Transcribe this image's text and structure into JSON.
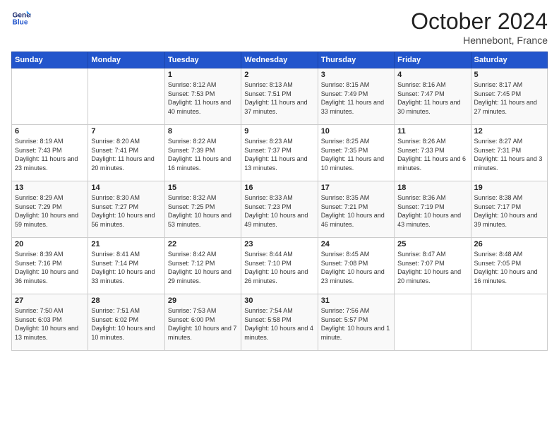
{
  "header": {
    "logo": {
      "line1": "General",
      "line2": "Blue"
    },
    "month_year": "October 2024",
    "location": "Hennebont, France"
  },
  "days_of_week": [
    "Sunday",
    "Monday",
    "Tuesday",
    "Wednesday",
    "Thursday",
    "Friday",
    "Saturday"
  ],
  "weeks": [
    [
      {
        "day": "",
        "sunrise": "",
        "sunset": "",
        "daylight": ""
      },
      {
        "day": "",
        "sunrise": "",
        "sunset": "",
        "daylight": ""
      },
      {
        "day": "1",
        "sunrise": "Sunrise: 8:12 AM",
        "sunset": "Sunset: 7:53 PM",
        "daylight": "Daylight: 11 hours and 40 minutes."
      },
      {
        "day": "2",
        "sunrise": "Sunrise: 8:13 AM",
        "sunset": "Sunset: 7:51 PM",
        "daylight": "Daylight: 11 hours and 37 minutes."
      },
      {
        "day": "3",
        "sunrise": "Sunrise: 8:15 AM",
        "sunset": "Sunset: 7:49 PM",
        "daylight": "Daylight: 11 hours and 33 minutes."
      },
      {
        "day": "4",
        "sunrise": "Sunrise: 8:16 AM",
        "sunset": "Sunset: 7:47 PM",
        "daylight": "Daylight: 11 hours and 30 minutes."
      },
      {
        "day": "5",
        "sunrise": "Sunrise: 8:17 AM",
        "sunset": "Sunset: 7:45 PM",
        "daylight": "Daylight: 11 hours and 27 minutes."
      }
    ],
    [
      {
        "day": "6",
        "sunrise": "Sunrise: 8:19 AM",
        "sunset": "Sunset: 7:43 PM",
        "daylight": "Daylight: 11 hours and 23 minutes."
      },
      {
        "day": "7",
        "sunrise": "Sunrise: 8:20 AM",
        "sunset": "Sunset: 7:41 PM",
        "daylight": "Daylight: 11 hours and 20 minutes."
      },
      {
        "day": "8",
        "sunrise": "Sunrise: 8:22 AM",
        "sunset": "Sunset: 7:39 PM",
        "daylight": "Daylight: 11 hours and 16 minutes."
      },
      {
        "day": "9",
        "sunrise": "Sunrise: 8:23 AM",
        "sunset": "Sunset: 7:37 PM",
        "daylight": "Daylight: 11 hours and 13 minutes."
      },
      {
        "day": "10",
        "sunrise": "Sunrise: 8:25 AM",
        "sunset": "Sunset: 7:35 PM",
        "daylight": "Daylight: 11 hours and 10 minutes."
      },
      {
        "day": "11",
        "sunrise": "Sunrise: 8:26 AM",
        "sunset": "Sunset: 7:33 PM",
        "daylight": "Daylight: 11 hours and 6 minutes."
      },
      {
        "day": "12",
        "sunrise": "Sunrise: 8:27 AM",
        "sunset": "Sunset: 7:31 PM",
        "daylight": "Daylight: 11 hours and 3 minutes."
      }
    ],
    [
      {
        "day": "13",
        "sunrise": "Sunrise: 8:29 AM",
        "sunset": "Sunset: 7:29 PM",
        "daylight": "Daylight: 10 hours and 59 minutes."
      },
      {
        "day": "14",
        "sunrise": "Sunrise: 8:30 AM",
        "sunset": "Sunset: 7:27 PM",
        "daylight": "Daylight: 10 hours and 56 minutes."
      },
      {
        "day": "15",
        "sunrise": "Sunrise: 8:32 AM",
        "sunset": "Sunset: 7:25 PM",
        "daylight": "Daylight: 10 hours and 53 minutes."
      },
      {
        "day": "16",
        "sunrise": "Sunrise: 8:33 AM",
        "sunset": "Sunset: 7:23 PM",
        "daylight": "Daylight: 10 hours and 49 minutes."
      },
      {
        "day": "17",
        "sunrise": "Sunrise: 8:35 AM",
        "sunset": "Sunset: 7:21 PM",
        "daylight": "Daylight: 10 hours and 46 minutes."
      },
      {
        "day": "18",
        "sunrise": "Sunrise: 8:36 AM",
        "sunset": "Sunset: 7:19 PM",
        "daylight": "Daylight: 10 hours and 43 minutes."
      },
      {
        "day": "19",
        "sunrise": "Sunrise: 8:38 AM",
        "sunset": "Sunset: 7:17 PM",
        "daylight": "Daylight: 10 hours and 39 minutes."
      }
    ],
    [
      {
        "day": "20",
        "sunrise": "Sunrise: 8:39 AM",
        "sunset": "Sunset: 7:16 PM",
        "daylight": "Daylight: 10 hours and 36 minutes."
      },
      {
        "day": "21",
        "sunrise": "Sunrise: 8:41 AM",
        "sunset": "Sunset: 7:14 PM",
        "daylight": "Daylight: 10 hours and 33 minutes."
      },
      {
        "day": "22",
        "sunrise": "Sunrise: 8:42 AM",
        "sunset": "Sunset: 7:12 PM",
        "daylight": "Daylight: 10 hours and 29 minutes."
      },
      {
        "day": "23",
        "sunrise": "Sunrise: 8:44 AM",
        "sunset": "Sunset: 7:10 PM",
        "daylight": "Daylight: 10 hours and 26 minutes."
      },
      {
        "day": "24",
        "sunrise": "Sunrise: 8:45 AM",
        "sunset": "Sunset: 7:08 PM",
        "daylight": "Daylight: 10 hours and 23 minutes."
      },
      {
        "day": "25",
        "sunrise": "Sunrise: 8:47 AM",
        "sunset": "Sunset: 7:07 PM",
        "daylight": "Daylight: 10 hours and 20 minutes."
      },
      {
        "day": "26",
        "sunrise": "Sunrise: 8:48 AM",
        "sunset": "Sunset: 7:05 PM",
        "daylight": "Daylight: 10 hours and 16 minutes."
      }
    ],
    [
      {
        "day": "27",
        "sunrise": "Sunrise: 7:50 AM",
        "sunset": "Sunset: 6:03 PM",
        "daylight": "Daylight: 10 hours and 13 minutes."
      },
      {
        "day": "28",
        "sunrise": "Sunrise: 7:51 AM",
        "sunset": "Sunset: 6:02 PM",
        "daylight": "Daylight: 10 hours and 10 minutes."
      },
      {
        "day": "29",
        "sunrise": "Sunrise: 7:53 AM",
        "sunset": "Sunset: 6:00 PM",
        "daylight": "Daylight: 10 hours and 7 minutes."
      },
      {
        "day": "30",
        "sunrise": "Sunrise: 7:54 AM",
        "sunset": "Sunset: 5:58 PM",
        "daylight": "Daylight: 10 hours and 4 minutes."
      },
      {
        "day": "31",
        "sunrise": "Sunrise: 7:56 AM",
        "sunset": "Sunset: 5:57 PM",
        "daylight": "Daylight: 10 hours and 1 minute."
      },
      {
        "day": "",
        "sunrise": "",
        "sunset": "",
        "daylight": ""
      },
      {
        "day": "",
        "sunrise": "",
        "sunset": "",
        "daylight": ""
      }
    ]
  ]
}
